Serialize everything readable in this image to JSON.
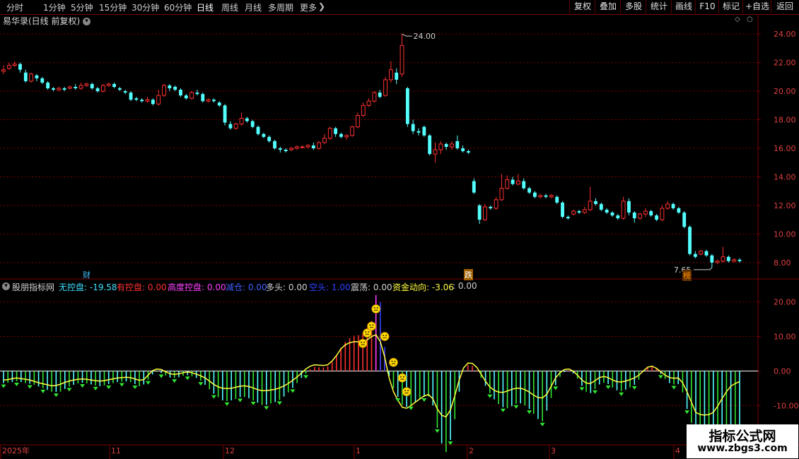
{
  "toolbar": {
    "timeframes": [
      "分时",
      "1分钟",
      "5分钟",
      "15分钟",
      "30分钟",
      "60分钟",
      "日线",
      "周线",
      "月线",
      "多周期",
      "更多"
    ],
    "active_timeframe": "日线",
    "right_buttons": [
      "复权",
      "叠加",
      "多股",
      "统计",
      "画线",
      "F10",
      "标记",
      "+自选",
      "返回"
    ]
  },
  "price_panel": {
    "stock_title": "易华录(日线 前复权)",
    "high_label": "24.00",
    "low_label": "7.65",
    "y_ticks": [
      "24.00",
      "22.00",
      "20.00",
      "18.00",
      "16.00",
      "14.00",
      "12.00",
      "10.00",
      "8.00"
    ],
    "event_markers": [
      "财",
      "跌",
      "榜"
    ]
  },
  "indicator_panel": {
    "name": "股朋指标网",
    "fields": [
      {
        "label": "无控盘:",
        "value": "-19.58",
        "color": "#40e0ff"
      },
      {
        "label": "有控盘:",
        "value": "0.00",
        "color": "#ff3030"
      },
      {
        "label": "高度控盘:",
        "value": "0.00",
        "color": "#ff40ff"
      },
      {
        "label": "减仓:",
        "value": "0.00",
        "color": "#4060ff"
      },
      {
        "label": "多头:",
        "value": "0.00",
        "color": "#d0d0d0"
      },
      {
        "label": "空头:",
        "value": "1.00",
        "color": "#3040ff"
      },
      {
        "label": "震荡:",
        "value": "0.00",
        "color": "#d0d0d0"
      },
      {
        "label": "资金动向:",
        "value": "-3.06",
        "color": "#ffff40"
      },
      {
        "label": ":",
        "value": "0.00",
        "color": "#d0d0d0"
      }
    ],
    "y_ticks": [
      "20.00",
      "10.00",
      "0.00",
      "-10.00"
    ]
  },
  "time_axis": {
    "labels": [
      "2025年",
      "11",
      "12",
      "1",
      "2",
      "3",
      "4"
    ]
  },
  "watermark": {
    "title": "指标公式网",
    "url": "www.zbgs3.com"
  },
  "colors": {
    "up": "#ff3030",
    "down": "#54ffff",
    "grid": "#7a0000",
    "yellow": "#ffff40",
    "green": "#32e632"
  },
  "chart_data": {
    "type": "candlestick",
    "title": "易华录(日线 前复权)",
    "ylim": [
      7.2,
      24.8
    ],
    "candles": [
      {
        "o": 21.4,
        "c": 21.5,
        "h": 21.8,
        "l": 21.2
      },
      {
        "o": 21.6,
        "c": 21.8,
        "h": 22.0,
        "l": 21.5
      },
      {
        "o": 21.8,
        "c": 21.9,
        "h": 22.1,
        "l": 21.7
      },
      {
        "o": 21.9,
        "c": 21.5,
        "h": 22.0,
        "l": 21.3
      },
      {
        "o": 21.3,
        "c": 20.7,
        "h": 21.5,
        "l": 20.6
      },
      {
        "o": 20.7,
        "c": 21.2,
        "h": 21.3,
        "l": 20.6
      },
      {
        "o": 21.1,
        "c": 20.9,
        "h": 21.2,
        "l": 20.7
      },
      {
        "o": 20.9,
        "c": 20.6,
        "h": 21.0,
        "l": 20.5
      },
      {
        "o": 20.6,
        "c": 20.2,
        "h": 20.7,
        "l": 20.1
      },
      {
        "o": 20.2,
        "c": 20.1,
        "h": 20.3,
        "l": 20.0
      },
      {
        "o": 20.1,
        "c": 20.2,
        "h": 20.3,
        "l": 20.0
      },
      {
        "o": 20.2,
        "c": 20.1,
        "h": 20.3,
        "l": 20.0
      },
      {
        "o": 20.2,
        "c": 20.3,
        "h": 20.4,
        "l": 20.1
      },
      {
        "o": 20.3,
        "c": 20.2,
        "h": 20.5,
        "l": 20.1
      },
      {
        "o": 20.2,
        "c": 20.4,
        "h": 20.6,
        "l": 20.1
      },
      {
        "o": 20.4,
        "c": 20.5,
        "h": 20.6,
        "l": 20.3
      },
      {
        "o": 20.5,
        "c": 20.2,
        "h": 20.6,
        "l": 20.1
      },
      {
        "o": 20.2,
        "c": 20.0,
        "h": 20.3,
        "l": 19.9
      },
      {
        "o": 20.0,
        "c": 20.4,
        "h": 20.5,
        "l": 19.9
      },
      {
        "o": 20.4,
        "c": 20.5,
        "h": 20.6,
        "l": 20.3
      },
      {
        "o": 20.5,
        "c": 20.3,
        "h": 20.6,
        "l": 20.2
      },
      {
        "o": 20.2,
        "c": 20.1,
        "h": 20.3,
        "l": 20.0
      },
      {
        "o": 20.0,
        "c": 19.9,
        "h": 20.1,
        "l": 19.8
      },
      {
        "o": 19.9,
        "c": 19.4,
        "h": 20.0,
        "l": 19.3
      },
      {
        "o": 19.5,
        "c": 19.4,
        "h": 19.6,
        "l": 19.3
      },
      {
        "o": 19.4,
        "c": 19.3,
        "h": 19.5,
        "l": 19.2
      },
      {
        "o": 19.3,
        "c": 19.4,
        "h": 19.6,
        "l": 19.2
      },
      {
        "o": 19.4,
        "c": 19.1,
        "h": 19.5,
        "l": 19.0
      },
      {
        "o": 19.1,
        "c": 19.7,
        "h": 20.1,
        "l": 19.0
      },
      {
        "o": 19.7,
        "c": 20.4,
        "h": 20.5,
        "l": 19.6
      },
      {
        "o": 20.4,
        "c": 20.2,
        "h": 20.5,
        "l": 20.0
      },
      {
        "o": 20.3,
        "c": 20.1,
        "h": 20.4,
        "l": 20.0
      },
      {
        "o": 20.1,
        "c": 19.7,
        "h": 20.2,
        "l": 19.6
      },
      {
        "o": 19.7,
        "c": 19.5,
        "h": 19.8,
        "l": 19.4
      },
      {
        "o": 19.5,
        "c": 19.9,
        "h": 20.0,
        "l": 19.4
      },
      {
        "o": 19.9,
        "c": 19.8,
        "h": 20.1,
        "l": 19.7
      },
      {
        "o": 19.8,
        "c": 19.3,
        "h": 19.9,
        "l": 19.2
      },
      {
        "o": 19.3,
        "c": 19.4,
        "h": 19.5,
        "l": 19.2
      },
      {
        "o": 19.4,
        "c": 19.3,
        "h": 19.5,
        "l": 19.2
      },
      {
        "o": 19.2,
        "c": 19.0,
        "h": 19.3,
        "l": 18.9
      },
      {
        "o": 19.0,
        "c": 17.8,
        "h": 19.1,
        "l": 17.6
      },
      {
        "o": 17.7,
        "c": 17.4,
        "h": 17.9,
        "l": 17.3
      },
      {
        "o": 17.4,
        "c": 17.7,
        "h": 17.8,
        "l": 17.3
      },
      {
        "o": 17.7,
        "c": 18.1,
        "h": 18.5,
        "l": 17.6
      },
      {
        "o": 18.1,
        "c": 17.9,
        "h": 18.2,
        "l": 17.8
      },
      {
        "o": 17.9,
        "c": 17.5,
        "h": 18.0,
        "l": 17.4
      },
      {
        "o": 17.5,
        "c": 17.0,
        "h": 17.6,
        "l": 16.9
      },
      {
        "o": 17.0,
        "c": 16.8,
        "h": 17.1,
        "l": 16.7
      },
      {
        "o": 16.8,
        "c": 16.5,
        "h": 16.9,
        "l": 16.4
      },
      {
        "o": 16.5,
        "c": 16.0,
        "h": 16.6,
        "l": 15.9
      },
      {
        "o": 16.0,
        "c": 15.9,
        "h": 16.1,
        "l": 15.7
      },
      {
        "o": 15.9,
        "c": 15.8,
        "h": 16.0,
        "l": 15.7
      },
      {
        "o": 15.9,
        "c": 16.0,
        "h": 16.1,
        "l": 15.8
      },
      {
        "o": 16.0,
        "c": 16.1,
        "h": 16.2,
        "l": 15.9
      },
      {
        "o": 16.1,
        "c": 16.1,
        "h": 16.2,
        "l": 16.0
      },
      {
        "o": 16.1,
        "c": 16.2,
        "h": 16.3,
        "l": 16.0
      },
      {
        "o": 16.2,
        "c": 16.0,
        "h": 16.4,
        "l": 15.9
      },
      {
        "o": 16.0,
        "c": 16.4,
        "h": 16.5,
        "l": 15.9
      },
      {
        "o": 16.4,
        "c": 16.7,
        "h": 17.0,
        "l": 16.3
      },
      {
        "o": 16.7,
        "c": 17.4,
        "h": 17.5,
        "l": 16.6
      },
      {
        "o": 17.4,
        "c": 17.0,
        "h": 17.5,
        "l": 16.8
      },
      {
        "o": 17.0,
        "c": 16.8,
        "h": 17.1,
        "l": 16.7
      },
      {
        "o": 16.8,
        "c": 16.9,
        "h": 17.0,
        "l": 16.6
      },
      {
        "o": 16.9,
        "c": 17.5,
        "h": 17.6,
        "l": 16.8
      },
      {
        "o": 17.5,
        "c": 18.3,
        "h": 18.5,
        "l": 17.4
      },
      {
        "o": 18.3,
        "c": 19.0,
        "h": 19.2,
        "l": 18.2
      },
      {
        "o": 19.0,
        "c": 19.3,
        "h": 19.5,
        "l": 18.9
      },
      {
        "o": 19.3,
        "c": 19.9,
        "h": 20.0,
        "l": 19.2
      },
      {
        "o": 19.9,
        "c": 19.6,
        "h": 20.1,
        "l": 19.5
      },
      {
        "o": 19.7,
        "c": 20.8,
        "h": 21.0,
        "l": 19.6
      },
      {
        "o": 20.8,
        "c": 21.5,
        "h": 22.1,
        "l": 20.6
      },
      {
        "o": 21.3,
        "c": 20.8,
        "h": 21.6,
        "l": 20.5
      },
      {
        "o": 21.2,
        "c": 23.2,
        "h": 24.0,
        "l": 21.0
      },
      {
        "o": 20.2,
        "c": 17.7,
        "h": 20.3,
        "l": 17.5
      },
      {
        "o": 17.7,
        "c": 17.2,
        "h": 18.0,
        "l": 17.0
      },
      {
        "o": 17.2,
        "c": 17.1,
        "h": 17.4,
        "l": 16.9
      },
      {
        "o": 17.5,
        "c": 16.9,
        "h": 17.6,
        "l": 16.8
      },
      {
        "o": 16.9,
        "c": 15.6,
        "h": 17.0,
        "l": 15.5
      },
      {
        "o": 15.6,
        "c": 15.9,
        "h": 16.4,
        "l": 15.0
      },
      {
        "o": 15.9,
        "c": 16.3,
        "h": 16.5,
        "l": 15.6
      },
      {
        "o": 16.3,
        "c": 16.1,
        "h": 16.4,
        "l": 15.9
      },
      {
        "o": 16.1,
        "c": 16.3,
        "h": 16.5,
        "l": 15.9
      },
      {
        "o": 16.5,
        "c": 16.0,
        "h": 16.9,
        "l": 15.9
      },
      {
        "o": 16.0,
        "c": 15.8,
        "h": 16.2,
        "l": 15.7
      },
      {
        "o": 15.8,
        "c": 15.7,
        "h": 15.9,
        "l": 15.6
      },
      {
        "o": 13.7,
        "c": 12.9,
        "h": 13.9,
        "l": 12.8
      },
      {
        "o": 12.0,
        "c": 11.0,
        "h": 12.1,
        "l": 10.7
      },
      {
        "o": 11.0,
        "c": 11.9,
        "h": 12.1,
        "l": 10.9
      },
      {
        "o": 11.9,
        "c": 11.8,
        "h": 12.0,
        "l": 11.7
      },
      {
        "o": 11.8,
        "c": 12.4,
        "h": 12.6,
        "l": 11.7
      },
      {
        "o": 12.4,
        "c": 13.2,
        "h": 14.2,
        "l": 12.3
      },
      {
        "o": 13.2,
        "c": 13.8,
        "h": 14.1,
        "l": 13.1
      },
      {
        "o": 13.8,
        "c": 13.5,
        "h": 14.0,
        "l": 13.4
      },
      {
        "o": 13.5,
        "c": 13.7,
        "h": 14.2,
        "l": 13.4
      },
      {
        "o": 13.7,
        "c": 13.2,
        "h": 13.9,
        "l": 13.1
      },
      {
        "o": 13.2,
        "c": 12.9,
        "h": 13.3,
        "l": 12.8
      },
      {
        "o": 12.9,
        "c": 12.6,
        "h": 13.0,
        "l": 12.5
      },
      {
        "o": 12.6,
        "c": 12.7,
        "h": 12.8,
        "l": 12.5
      },
      {
        "o": 12.7,
        "c": 12.6,
        "h": 12.8,
        "l": 12.5
      },
      {
        "o": 12.6,
        "c": 12.7,
        "h": 12.8,
        "l": 12.5
      },
      {
        "o": 12.6,
        "c": 12.2,
        "h": 12.7,
        "l": 12.1
      },
      {
        "o": 12.2,
        "c": 11.2,
        "h": 12.3,
        "l": 11.1
      },
      {
        "o": 11.2,
        "c": 11.1,
        "h": 11.3,
        "l": 11.0
      },
      {
        "o": 11.4,
        "c": 11.6,
        "h": 11.7,
        "l": 11.3
      },
      {
        "o": 11.6,
        "c": 11.5,
        "h": 11.7,
        "l": 11.4
      },
      {
        "o": 11.5,
        "c": 11.7,
        "h": 11.9,
        "l": 11.4
      },
      {
        "o": 11.7,
        "c": 12.3,
        "h": 13.3,
        "l": 11.6
      },
      {
        "o": 12.3,
        "c": 12.1,
        "h": 12.5,
        "l": 12.0
      },
      {
        "o": 12.1,
        "c": 11.7,
        "h": 12.2,
        "l": 11.6
      },
      {
        "o": 11.7,
        "c": 11.5,
        "h": 11.8,
        "l": 11.4
      },
      {
        "o": 11.5,
        "c": 11.3,
        "h": 11.6,
        "l": 11.2
      },
      {
        "o": 11.3,
        "c": 11.1,
        "h": 11.4,
        "l": 11.0
      },
      {
        "o": 11.1,
        "c": 12.3,
        "h": 12.6,
        "l": 11.0
      },
      {
        "o": 12.3,
        "c": 11.5,
        "h": 12.5,
        "l": 11.3
      },
      {
        "o": 11.5,
        "c": 11.1,
        "h": 11.6,
        "l": 10.8
      },
      {
        "o": 11.1,
        "c": 11.4,
        "h": 11.5,
        "l": 11.0
      },
      {
        "o": 11.4,
        "c": 11.6,
        "h": 11.8,
        "l": 11.2
      },
      {
        "o": 11.6,
        "c": 11.3,
        "h": 11.7,
        "l": 11.2
      },
      {
        "o": 11.3,
        "c": 11.0,
        "h": 11.4,
        "l": 10.9
      },
      {
        "o": 11.0,
        "c": 11.8,
        "h": 12.0,
        "l": 10.9
      },
      {
        "o": 11.8,
        "c": 12.1,
        "h": 12.3,
        "l": 11.7
      },
      {
        "o": 12.1,
        "c": 11.8,
        "h": 12.2,
        "l": 11.7
      },
      {
        "o": 11.8,
        "c": 11.5,
        "h": 11.9,
        "l": 11.4
      },
      {
        "o": 11.5,
        "c": 10.5,
        "h": 11.6,
        "l": 10.4
      },
      {
        "o": 10.5,
        "c": 8.6,
        "h": 10.6,
        "l": 8.5
      },
      {
        "o": 8.6,
        "c": 8.4,
        "h": 8.8,
        "l": 8.3
      },
      {
        "o": 8.6,
        "c": 8.8,
        "h": 8.9,
        "l": 8.5
      },
      {
        "o": 8.8,
        "c": 8.5,
        "h": 8.9,
        "l": 8.4
      },
      {
        "o": 8.5,
        "c": 8.0,
        "h": 8.6,
        "l": 7.65
      },
      {
        "o": 8.0,
        "c": 8.1,
        "h": 8.2,
        "l": 7.9
      },
      {
        "o": 8.1,
        "c": 8.4,
        "h": 9.1,
        "l": 8.0
      },
      {
        "o": 8.4,
        "c": 8.1,
        "h": 8.5,
        "l": 8.0
      },
      {
        "o": 8.1,
        "c": 8.2,
        "h": 8.3,
        "l": 8.0
      },
      {
        "o": 8.2,
        "c": 8.1,
        "h": 8.3,
        "l": 8.0
      }
    ],
    "indicator": {
      "ylim": [
        -21,
        23
      ],
      "fund_flow": [
        -2.6,
        -2.5,
        -2.2,
        -2.0,
        -2.2,
        -2.4,
        -2.6,
        -3.0,
        -3.4,
        -3.7,
        -4.0,
        -4.3,
        -4.2,
        -3.8,
        -3.3,
        -2.9,
        -2.6,
        -2.4,
        -2.3,
        -2.4,
        -2.6,
        -2.8,
        -2.9,
        -2.8,
        -2.5,
        -2.3,
        -2.0,
        -1.9,
        -1.8,
        -1.9,
        -2.3,
        -2.7,
        -2.5,
        -1.2,
        0.1,
        0.6,
        0.4,
        -0.2,
        -0.8,
        -1.0,
        -0.8,
        -0.5,
        -0.3,
        -0.5,
        -0.9,
        -1.4,
        -2.0,
        -2.9,
        -3.9,
        -4.6,
        -5.0,
        -5.1,
        -5.0,
        -4.7,
        -4.4,
        -4.3,
        -4.5,
        -4.9,
        -5.4,
        -5.7,
        -5.7,
        -5.5,
        -5.3,
        -4.9,
        -4.3,
        -3.6,
        -2.7,
        -1.7,
        -0.6,
        0.6,
        1.4,
        1.8,
        1.7,
        1.6,
        1.8,
        2.9,
        4.5,
        6.4,
        7.6,
        8.2,
        8.5,
        8.5,
        8.6,
        9.0,
        10.0,
        10.5,
        8.5,
        4.0,
        -2.0,
        -6.0,
        -8.5,
        -10.5,
        -10.8,
        -10.0,
        -9.0,
        -8.1,
        -7.2,
        -6.8,
        -8.1,
        -11.0,
        -12.8,
        -13.3,
        -11.3,
        -7.2,
        -2.6,
        0.9,
        2.3,
        2.2,
        1.1,
        -0.9,
        -3.0,
        -4.6,
        -5.6,
        -6.1,
        -6.2,
        -5.8,
        -5.3,
        -5.0,
        -5.0,
        -5.4,
        -6.1,
        -7.0,
        -7.7,
        -7.8,
        -6.7,
        -4.4,
        -2.0,
        -0.5,
        0.4,
        0.6,
        0.0,
        -1.2,
        -2.6,
        -3.5,
        -3.6,
        -2.8,
        -1.9,
        -1.6,
        -1.9,
        -2.6,
        -3.1,
        -3.2,
        -2.9,
        -2.5,
        -2.0,
        -1.2,
        0.0,
        1.1,
        1.4,
        0.8,
        -0.2,
        -1.2,
        -1.9,
        -2.1,
        -2.0,
        -3.4,
        -6.0,
        -9.0,
        -12.0,
        -12.6,
        -12.8,
        -12.6,
        -12.0,
        -10.2,
        -8.0,
        -6.0,
        -4.4,
        -3.6,
        -3.1
      ],
      "bars": [
        -3.5,
        -3.4,
        -3.2,
        -3.0,
        -3.2,
        -3.5,
        -3.7,
        -4.0,
        -4.5,
        -5.0,
        -5.5,
        -6.0,
        -6.1,
        -6.0,
        -5.2,
        -4.5,
        -4.0,
        -3.6,
        -3.4,
        -3.6,
        -3.9,
        -4.2,
        -4.4,
        -4.2,
        -3.8,
        -3.5,
        -3.2,
        -3.1,
        -3.0,
        -3.2,
        -3.8,
        -4.4,
        -3.9,
        -2.5,
        -1.0,
        -0.2,
        -0.6,
        -1.3,
        -1.9,
        -2.0,
        -1.8,
        -1.4,
        -1.2,
        -1.5,
        -2.0,
        -2.8,
        -4.0,
        -5.3,
        -6.6,
        -7.6,
        -8.5,
        -8.7,
        -8.5,
        -8.1,
        -7.6,
        -7.5,
        -7.9,
        -8.5,
        -9.2,
        -9.8,
        -9.8,
        -9.4,
        -9.0,
        -8.4,
        -7.4,
        -6.2,
        -4.9,
        -3.5,
        -2.0,
        -0.8,
        0.5,
        1.2,
        1.1,
        1.0,
        1.4,
        2.6,
        4.6,
        6.7,
        8.4,
        9.5,
        10.2,
        10.4,
        11.0,
        12.5,
        14.5,
        16.0,
        12.2,
        6.0,
        -1.5,
        -5.0,
        -7.5,
        -9.8,
        -10.4,
        -9.9,
        -9.0,
        -8.2,
        -7.5,
        -7.4,
        -10.0,
        -16.5,
        -21.0,
        -23.5,
        -20.0,
        -14.0,
        -6.0,
        0.0,
        1.8,
        1.5,
        0.2,
        -2.0,
        -4.3,
        -6.4,
        -8.2,
        -9.6,
        -10.5,
        -10.8,
        -10.2,
        -9.5,
        -9.4,
        -10.0,
        -11.0,
        -12.4,
        -13.9,
        -14.6,
        -11.5,
        -7.8,
        -4.1,
        -1.7,
        -0.3,
        0.2,
        -0.7,
        -2.2,
        -4.3,
        -6.0,
        -6.4,
        -5.2,
        -3.9,
        -3.4,
        -3.8,
        -4.8,
        -5.6,
        -5.8,
        -5.4,
        -4.8,
        -4.0,
        -2.5,
        -0.2,
        1.2,
        1.5,
        0.6,
        -0.8,
        -2.3,
        -3.5,
        -3.9,
        -3.8,
        -6.2,
        -11.0,
        -15.0,
        -17.4,
        -18.6,
        -19.2,
        -19.4,
        -19.1,
        -18.6,
        -18.0,
        -19.4,
        -20.3,
        -19.8,
        -19.6
      ]
    }
  }
}
